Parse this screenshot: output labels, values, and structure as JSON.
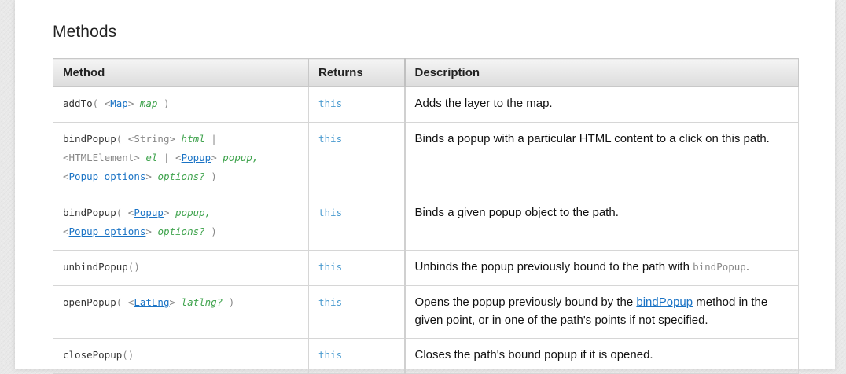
{
  "section": {
    "title": "Methods"
  },
  "table": {
    "headers": {
      "method": "Method",
      "returns": "Returns",
      "description": "Description"
    },
    "rows": [
      {
        "method_name": "addTo",
        "open": "(",
        "close": ")",
        "arg1_type_open": "<",
        "arg1_type_link": "Map",
        "arg1_type_close": ">",
        "arg1_name": "map",
        "returns": "this",
        "description": "Adds the layer to the map."
      },
      {
        "method_name": "bindPopup",
        "open": "(",
        "close": ")",
        "arg1_type": "<String>",
        "arg1_name": "html",
        "sep1": "|",
        "arg2_type": "<HTMLElement>",
        "arg2_name": "el",
        "sep2": "|",
        "arg3_type_open": "<",
        "arg3_type_link": "Popup",
        "arg3_type_close": ">",
        "arg3_name": "popup,",
        "arg4_type_open": "<",
        "arg4_type_link": "Popup options",
        "arg4_type_close": ">",
        "arg4_name": "options?",
        "returns": "this",
        "description": "Binds a popup with a particular HTML content to a click on this path."
      },
      {
        "method_name": "bindPopup",
        "open": "(",
        "close": ")",
        "arg1_type_open": "<",
        "arg1_type_link": "Popup",
        "arg1_type_close": ">",
        "arg1_name": "popup,",
        "arg2_type_open": "<",
        "arg2_type_link": "Popup options",
        "arg2_type_close": ">",
        "arg2_name": "options?",
        "returns": "this",
        "description": "Binds a given popup object to the path."
      },
      {
        "method_name": "unbindPopup",
        "empty_args": "()",
        "returns": "this",
        "description_pre": "Unbinds the popup previously bound to the path with",
        "description_code": "bindPopup",
        "description_post": "."
      },
      {
        "method_name": "openPopup",
        "open": "(",
        "close": ")",
        "arg1_type_open": "<",
        "arg1_type_link": "LatLng",
        "arg1_type_close": ">",
        "arg1_name": "latlng?",
        "returns": "this",
        "description_pre": "Opens the popup previously bound by the",
        "description_link": "bindPopup",
        "description_post": "method in the given point, or in one of the path's points if not specified."
      },
      {
        "method_name": "closePopup",
        "empty_args": "()",
        "returns": "this",
        "description": "Closes the path's bound popup if it is opened."
      }
    ]
  }
}
